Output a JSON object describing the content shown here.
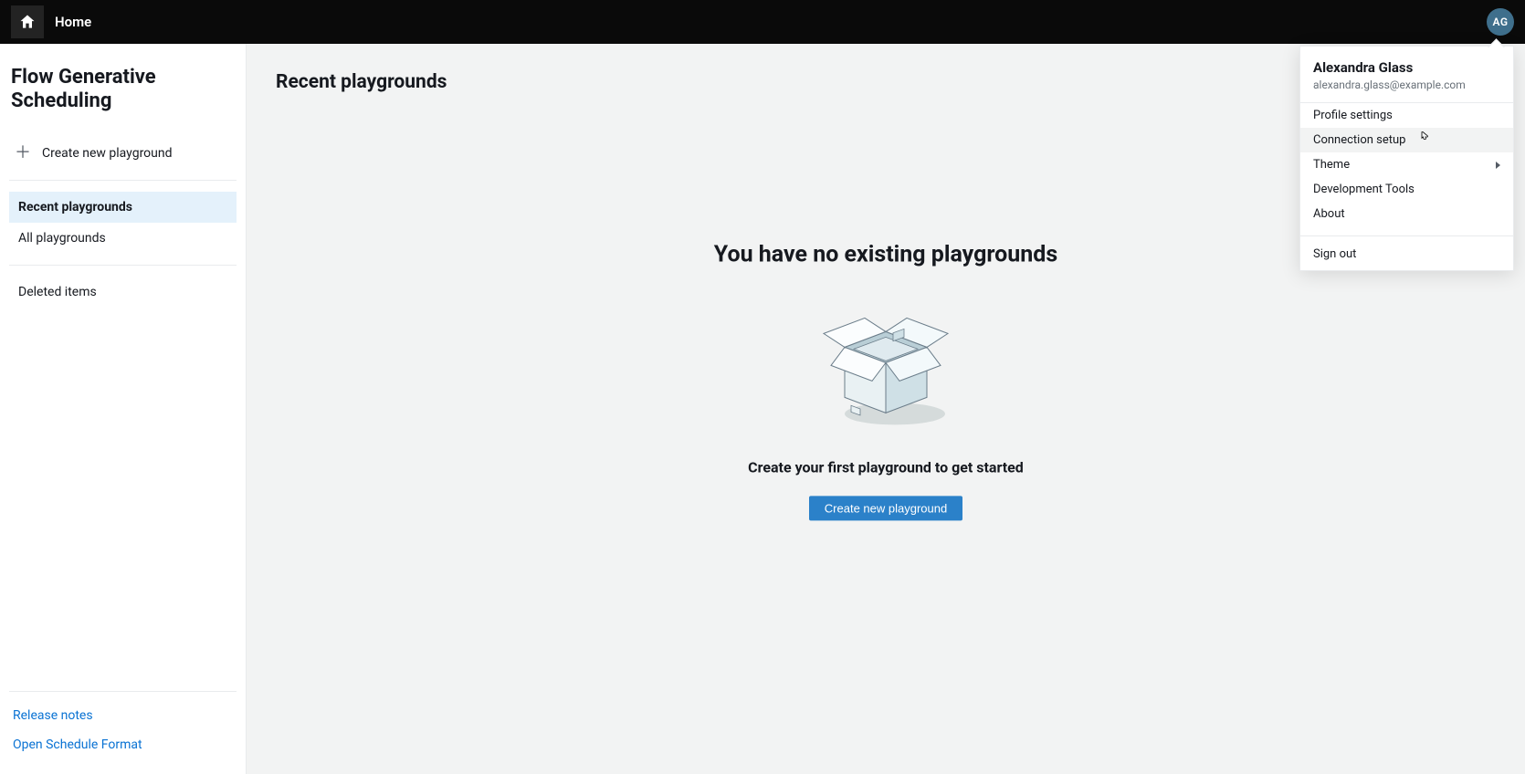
{
  "topbar": {
    "home_label": "Home",
    "avatar_initials": "AG"
  },
  "sidebar": {
    "app_title": "Flow Generative Scheduling",
    "create_label": "Create new playground",
    "nav": [
      {
        "label": "Recent playgrounds",
        "active": true
      },
      {
        "label": "All playgrounds",
        "active": false
      }
    ],
    "deleted_label": "Deleted items",
    "footer_links": [
      "Release notes",
      "Open Schedule Format"
    ]
  },
  "main": {
    "heading": "Recent playgrounds",
    "empty_title": "You have no existing playgrounds",
    "empty_sub": "Create your first playground to get started",
    "empty_cta": "Create new playground"
  },
  "user_menu": {
    "name": "Alexandra Glass",
    "email": "alexandra.glass@example.com",
    "items": [
      {
        "label": "Profile settings",
        "submenu": false,
        "hovered": false
      },
      {
        "label": "Connection setup",
        "submenu": false,
        "hovered": true
      },
      {
        "label": "Theme",
        "submenu": true,
        "hovered": false
      },
      {
        "label": "Development Tools",
        "submenu": false,
        "hovered": false
      },
      {
        "label": "About",
        "submenu": false,
        "hovered": false
      }
    ],
    "signout": "Sign out"
  }
}
